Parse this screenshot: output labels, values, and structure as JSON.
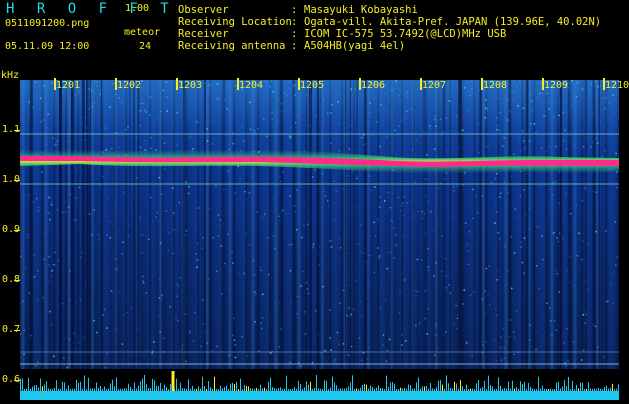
{
  "header": {
    "brand": "H R O F F T",
    "version": "1.00",
    "filename": "0511091200.png",
    "datetime": "05.11.09 12:00",
    "meteor_label": "meteor",
    "meteor_count": "24",
    "observer_key": "Observer",
    "observer_val": "Masayuki Kobayashi",
    "location_key": "Receiving Location",
    "location_val": "Ogata-vill. Akita-Pref. JAPAN (139.96E, 40.02N)",
    "receiver_key": "Receiver",
    "receiver_val": "ICOM IC-575 53.7492(@LCD)MHz USB",
    "antenna_key": "Receiving antenna",
    "antenna_val": "A504HB(yagi 4el)",
    "colon": ":"
  },
  "spectrogram": {
    "unit_label": "kHz",
    "y_ticks": [
      "1.1",
      "1.0",
      "0.9",
      "0.8",
      "0.7",
      "0.6"
    ],
    "time_labels": [
      "1201",
      "1202",
      "1203",
      "1204",
      "1205",
      "1206",
      "1207",
      "1208",
      "1209",
      "1210"
    ],
    "colors": {
      "signal": "#ff2a8c",
      "halo": "#38e070",
      "guide": "#6cd0c8",
      "meteor_spike": "#f6ee22",
      "bg": "#061a58"
    }
  }
}
